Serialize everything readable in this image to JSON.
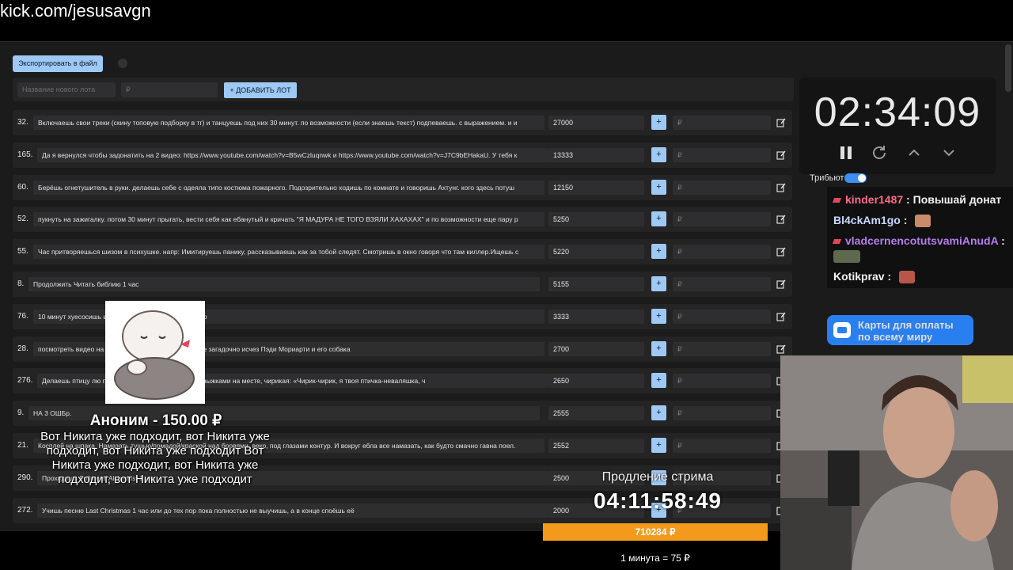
{
  "url": "kick.com/jesusavgn",
  "auction": {
    "export_label": "Экспортировать в файл",
    "new_lot_placeholder": "Название нового лота",
    "amount_placeholder": "₽",
    "add_lot_label": "+ ДОБАВИТЬ ЛОТ",
    "lots": [
      {
        "num": "32.",
        "desc": "Включаешь свои треки (скину топовую подборку в тг) и танцуешь под них 30 минут. по возможности (если знаешь текст) подпеваешь. с выражением. и и",
        "amount": "27000"
      },
      {
        "num": "165.",
        "desc": "Да я вернулся чтобы задонатить на 2 видео: https://www.youtube.com/watch?v=B5wCzluqnwk и https://www.youtube.com/watch?v=J7C9bEHakaU. У тебя к",
        "amount": "13333"
      },
      {
        "num": "60.",
        "desc": "Берёшь огнетушитель в руки. делаешь себе с одеяла типо костюма пожарного. Подозрительно ходишь по комнате и говоришь Ахтунг. кого здесь потуш",
        "amount": "12150"
      },
      {
        "num": "52.",
        "desc": "пукнуть на зажигалку. потом 30 минут прыгать, вести себя как ебанутый и кричать \"Я МАДУРА НЕ ТОГО ВЗЯЛИ ХАХАХАХ\" и по возможности еще пару р",
        "amount": "5250"
      },
      {
        "num": "55.",
        "desc": "Час притворяешься шизом в психушке. напр: Имитируешь панику, рассказываешь как за тобой следят. Смотришь в окно говоря что там киллер.Ищешь с",
        "amount": "5220"
      },
      {
        "num": "8.",
        "desc": "Продолжить Читать библию 1 час",
        "amount": "5155"
      },
      {
        "num": "76.",
        "desc": "10 минут хуесосишь                         ь с позором, несмотря на таймер",
        "amount": "3333"
      },
      {
        "num": "28.",
        "desc": "посмотреть видео на                          с населением из 11 человек, где загадочно исчез Пэди Мориарти и его собака",
        "amount": "2700"
      },
      {
        "num": "276.",
        "desc": "Делаешь птицу лю                            после летаешь вокруг камеры прыжками на месте, чирикая: «Чирик-чирик, я твоя птичка-неваляшка, ч",
        "amount": "2650"
      },
      {
        "num": "9.",
        "desc": "НА 3 ОШБр.",
        "amount": "2555"
      },
      {
        "num": "21.",
        "desc": "Косплей на шпака. Намазать тушью/помадой/краской над бровями, веко, под глазами контур. И вокруг ебла все намазать, как будто смачно гавна поел.",
        "amount": "2552"
      },
      {
        "num": "290.",
        "desc": "Проходишь Fullmetal Alchemist 1 час",
        "amount": "2500"
      },
      {
        "num": "272.",
        "desc": "Учишь песню Last Christmas 1 час или до тех пор пока полностью не выучишь, а в конце споёшь её",
        "amount": "2000"
      }
    ],
    "plus_label": "+",
    "currency_label": "₽"
  },
  "timer": {
    "value": "02:34:09",
    "icons": [
      "pause-icon",
      "refresh-icon",
      "chevron-up-icon",
      "chevron-down-icon"
    ]
  },
  "chat": {
    "tribute_label": "Трибьют",
    "messages": [
      {
        "user": "kinder1487",
        "text": "Повышай донат",
        "color": "#ff6b8a",
        "badge": true,
        "emote": ""
      },
      {
        "user": "Bl4ckAm1go",
        "text": "",
        "color": "#c8d8ff",
        "badge": false,
        "emote": "#c98b6a"
      },
      {
        "user": "vladcernencotutsvamiAnudA",
        "text": "",
        "color": "#b77cf0",
        "badge": true,
        "emote": "#5d6a4e"
      },
      {
        "user": "Kotikprav",
        "text": "",
        "color": "#f2f2f2",
        "badge": false,
        "emote": "#b9564a"
      }
    ]
  },
  "card_ad": {
    "line1": "Карты для оплаты",
    "line2": "по всему миру"
  },
  "alert": {
    "title": "Аноним - 150.00 ₽",
    "message": "Вот Никита уже подходит, вот Никита уже подходит, вот Никита уже подходит Вот Никита уже подходит, вот Никита уже подходит, вот Никита уже подходит"
  },
  "extension": {
    "label": "Продление стрима",
    "timer": "04:11:58:49",
    "total": "710284 ₽",
    "rate": "1 минута = 75 ₽"
  },
  "colors": {
    "accent": "#9ec9f5",
    "progress": "#f39a1d",
    "card_blue": "#2a7ff0"
  }
}
